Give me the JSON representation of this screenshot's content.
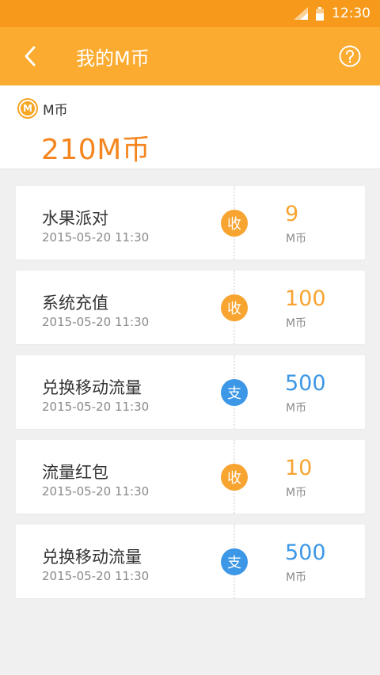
{
  "status_bar": {
    "time": "12:30"
  },
  "header": {
    "title": "我的M币"
  },
  "summary": {
    "coin_glyph": "M",
    "label": "M币",
    "total": "210M币"
  },
  "colors": {
    "header": "#fbab2f",
    "status_bar": "#f79a1c",
    "income": "#f8a431",
    "expense": "#3c97e6",
    "total": "#f5861f"
  },
  "transactions": [
    {
      "title": "水果派对",
      "time": "2015-05-20 11:30",
      "type": "income",
      "badge": "收",
      "amount": "9",
      "unit": "M币"
    },
    {
      "title": "系统充值",
      "time": "2015-05-20 11:30",
      "type": "income",
      "badge": "收",
      "amount": "100",
      "unit": "M币"
    },
    {
      "title": "兑换移动流量",
      "time": "2015-05-20 11:30",
      "type": "expense",
      "badge": "支",
      "amount": "500",
      "unit": "M币"
    },
    {
      "title": "流量红包",
      "time": "2015-05-20 11:30",
      "type": "income",
      "badge": "收",
      "amount": "10",
      "unit": "M币"
    },
    {
      "title": "兑换移动流量",
      "time": "2015-05-20 11:30",
      "type": "expense",
      "badge": "支",
      "amount": "500",
      "unit": "M币"
    }
  ]
}
